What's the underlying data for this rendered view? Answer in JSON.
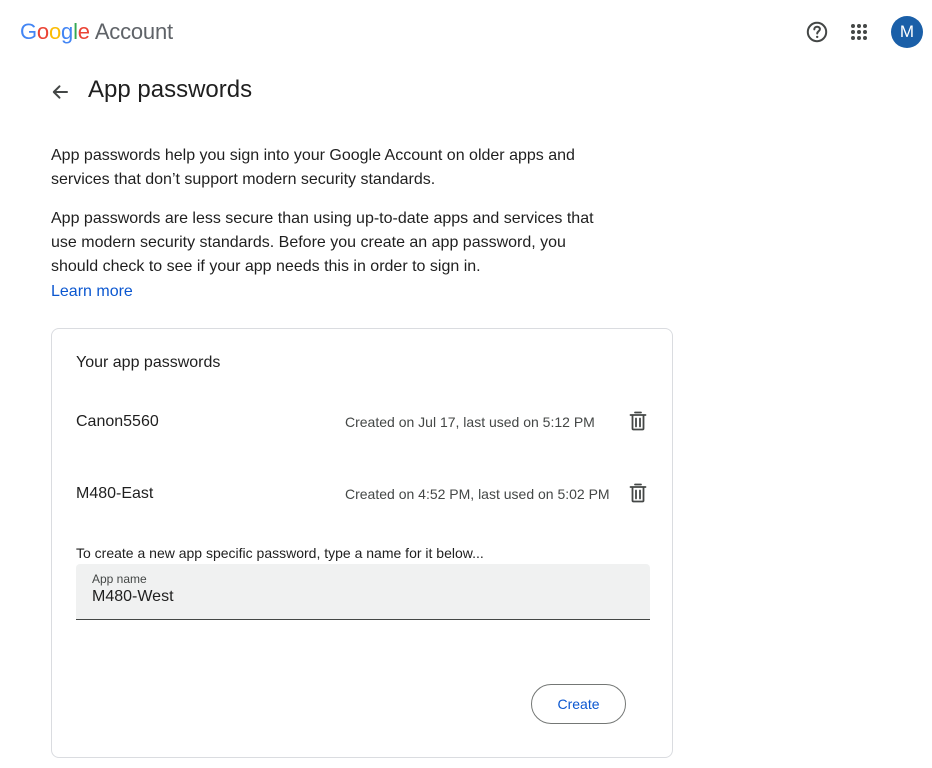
{
  "header": {
    "logo_letters": [
      "G",
      "o",
      "o",
      "g",
      "l",
      "e"
    ],
    "logo_suffix": "Account",
    "avatar_initial": "M",
    "icons": [
      "help-icon",
      "apps-grid-icon"
    ]
  },
  "page": {
    "title": "App passwords",
    "paragraph_1": "App passwords help you sign into your Google Account on older apps and services that don’t support modern security standards.",
    "paragraph_2": "App passwords are less secure than using up-to-date apps and services that use modern security standards. Before you create an app password, you should check to see if your app needs this in order to sign in.",
    "learn_more": "Learn more"
  },
  "card": {
    "title": "Your app passwords",
    "passwords": [
      {
        "name": "Canon5560",
        "meta": "Created on Jul 17, last used on 5:12 PM"
      },
      {
        "name": "M480-East",
        "meta": "Created on 4:52 PM, last used on 5:02 PM"
      }
    ],
    "hint": "To create a new app specific password, type a name for it below...",
    "field_label": "App name",
    "field_value": "M480-West",
    "create_label": "Create"
  },
  "colors": {
    "accent": "#0b57d0",
    "avatar_bg": "#1a5fa8",
    "field_bg": "#f0f1f1"
  }
}
